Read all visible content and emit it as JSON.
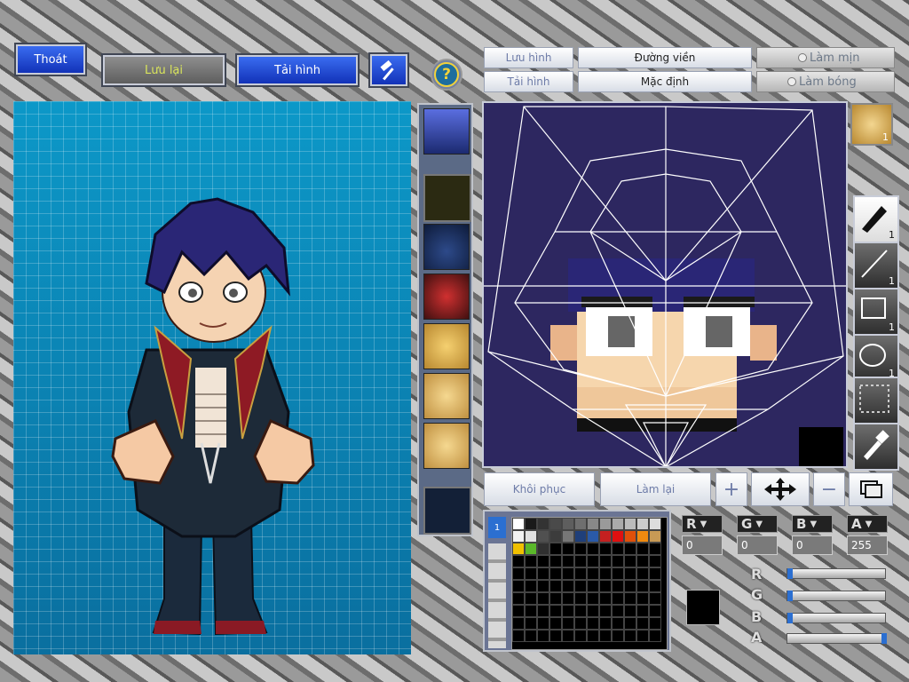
{
  "toolbar_left": {
    "exit_label": "Thoát",
    "save_label": "Lưu lại",
    "reload_label": "Tải hình"
  },
  "editor_header": {
    "save_image_label": "Lưu hình",
    "load_image_label": "Tải hình",
    "outline_label": "Đường viền",
    "default_label": "Mặc định",
    "smooth_label": "Làm mịn",
    "shade_label": "Làm bóng"
  },
  "editor_actions": {
    "restore_label": "Khôi phục",
    "redo_label": "Làm lại",
    "plus_symbol": "+",
    "minus_symbol": "−"
  },
  "tools": {
    "face_count": "1",
    "pen_count": "1",
    "line_count": "1",
    "rect_count": "1",
    "ellipse_count": "1"
  },
  "color_channels": {
    "r_label": "R",
    "g_label": "G",
    "b_label": "B",
    "a_label": "A",
    "r_value": "0",
    "g_value": "0",
    "b_value": "0",
    "a_value": "255",
    "r_level": 0.0,
    "g_level": 0.0,
    "b_level": 0.0,
    "a_level": 1.0,
    "current_color": "#000000"
  },
  "palette": {
    "colors": [
      "#ffffff",
      "#1a1a1a",
      "#333333",
      "#4a4a4a",
      "#5e5e5e",
      "#6f6f6f",
      "#888888",
      "#9a9a9a",
      "#aaaaaa",
      "#bbbbbb",
      "#cccccc",
      "#dddddd",
      "#f2f2f2",
      "#e0e0e0",
      "#505050",
      "#3c3c3c",
      "#777777",
      "#1f3f7a",
      "#2a5aa8",
      "#c42020",
      "#e01010",
      "#e0500a",
      "#f08a10",
      "#c89a55",
      "#f0c000",
      "#5ab82a",
      "#303030"
    ]
  },
  "layer_tab_label": "1",
  "help_icon": "?"
}
